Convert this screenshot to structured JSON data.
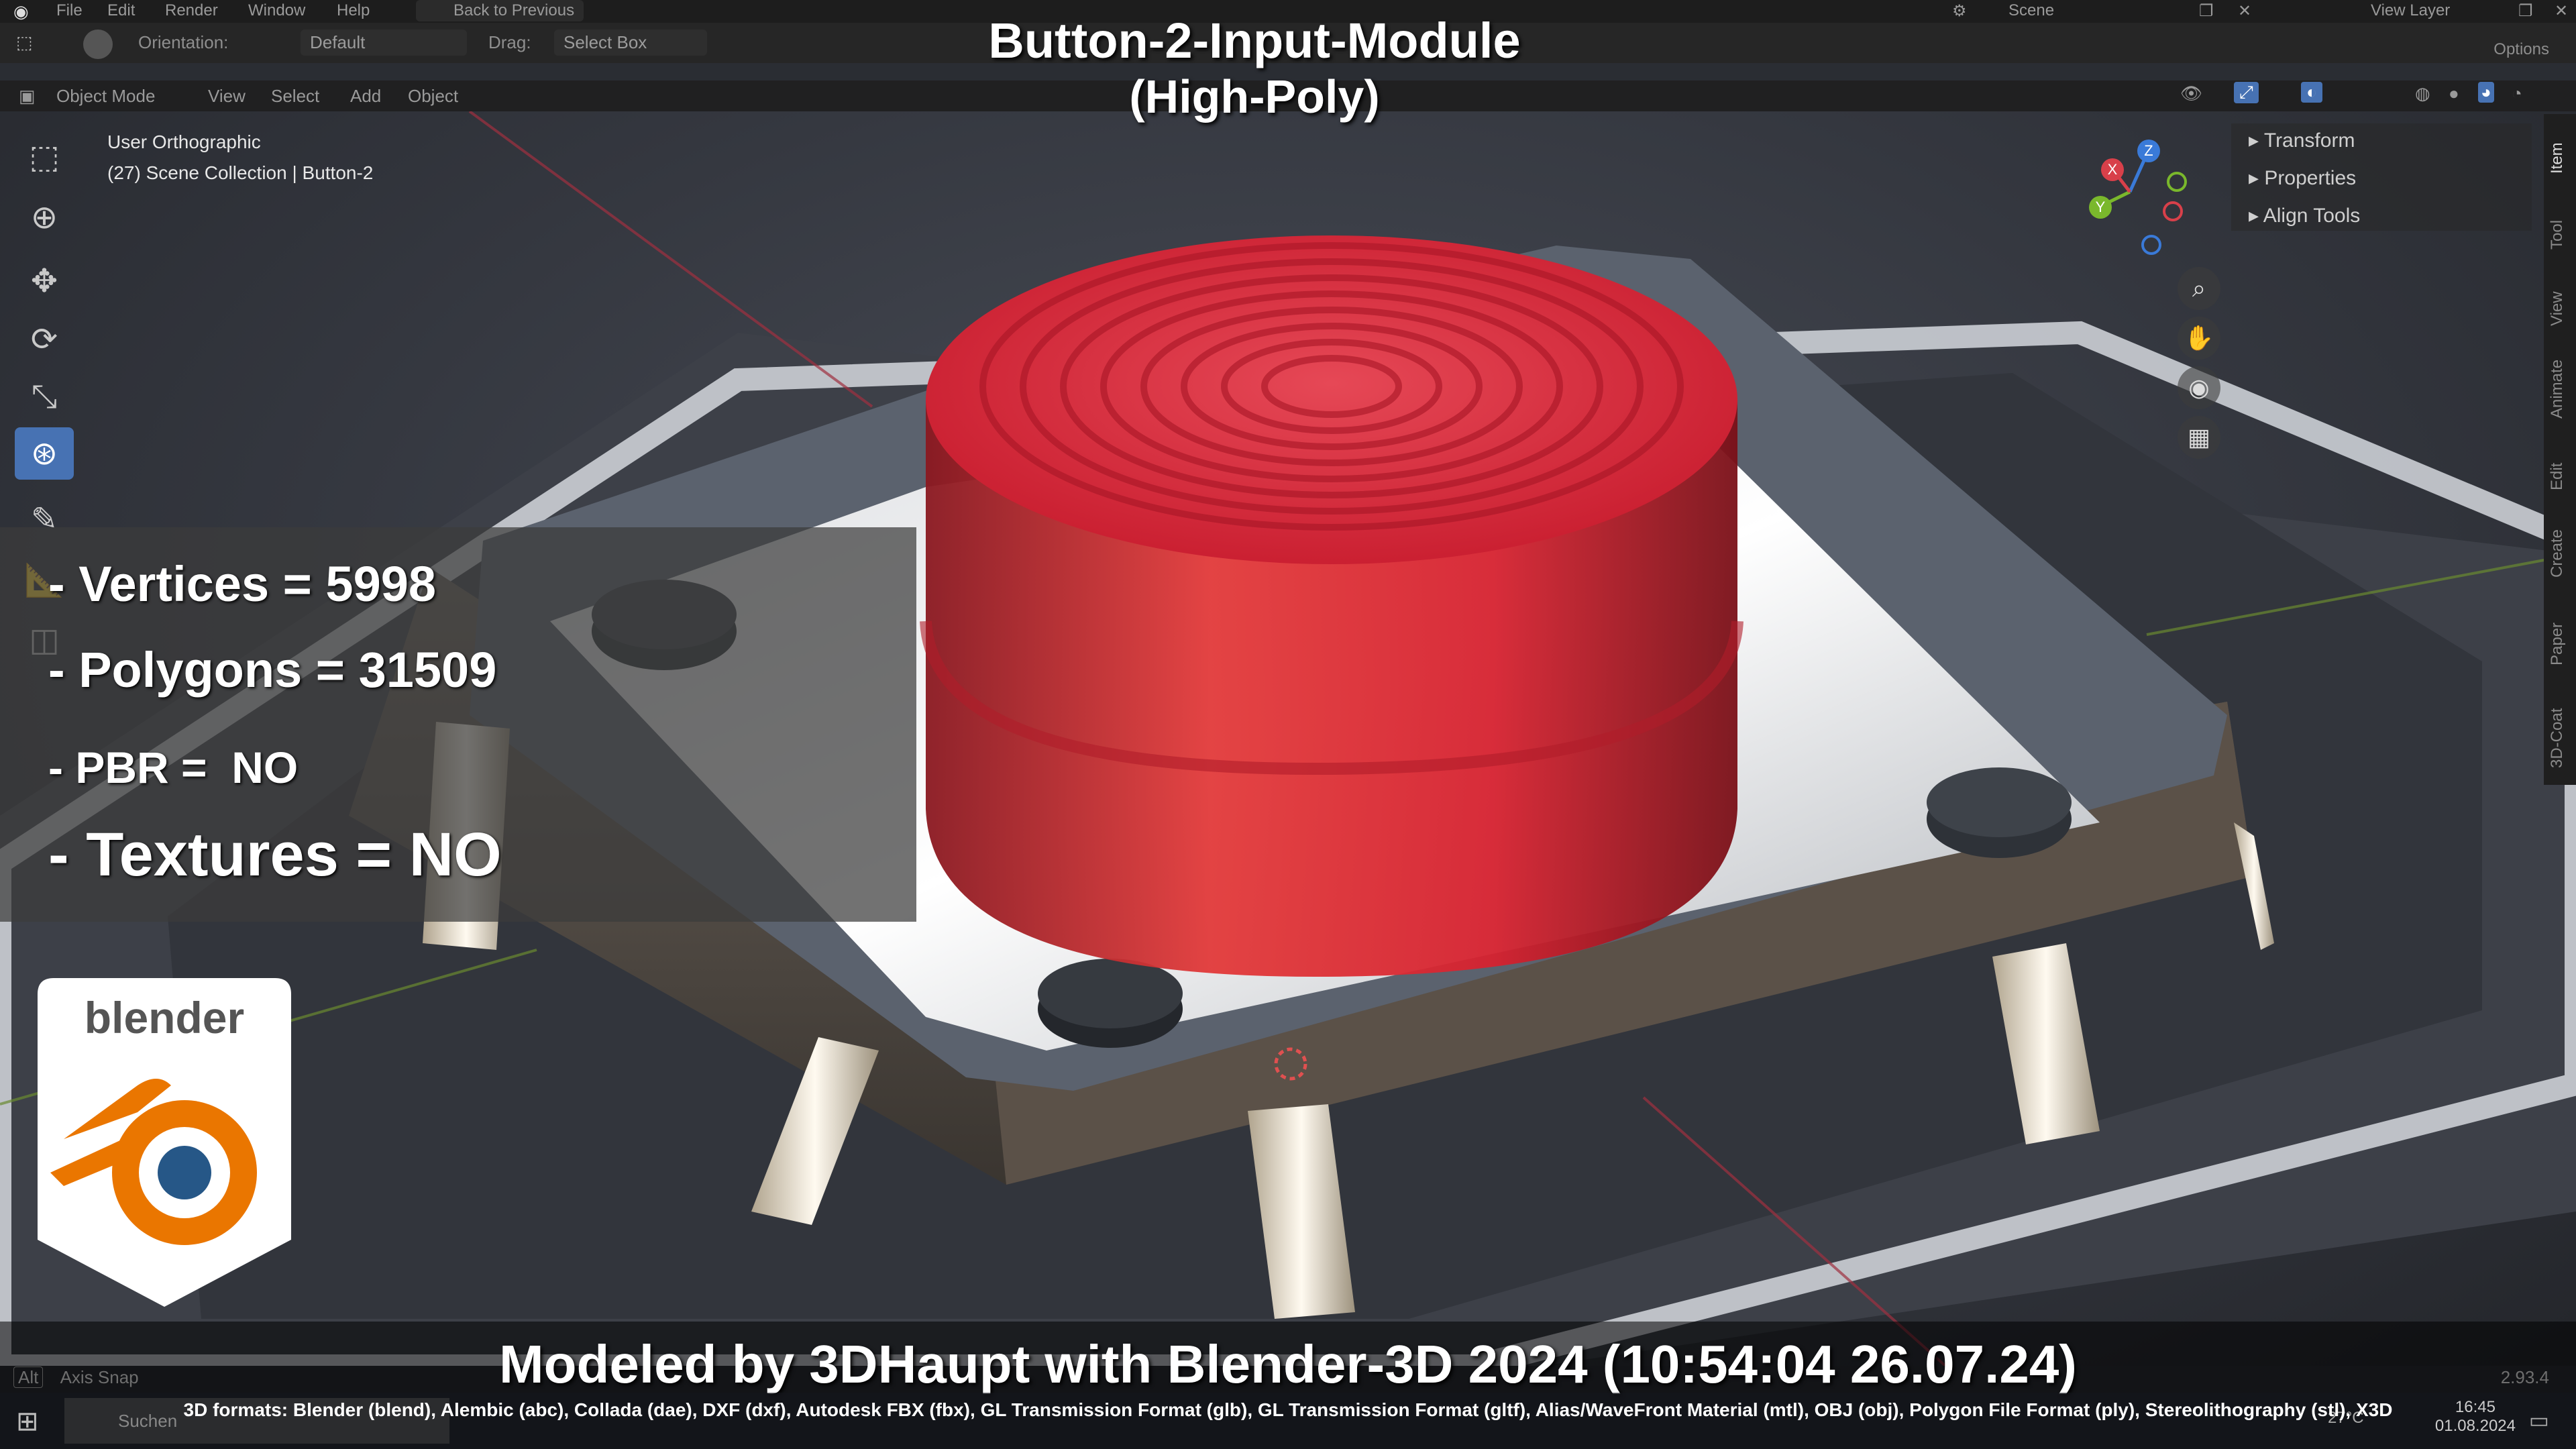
{
  "menubar": {
    "items": [
      "File",
      "Edit",
      "Render",
      "Window",
      "Help"
    ],
    "back_button": "Back to Previous",
    "scene_label": "Scene",
    "view_layer_label": "View Layer"
  },
  "toolheader": {
    "orientation_label": "Orientation:",
    "orientation_value": "Default",
    "drag_label": "Drag:",
    "drag_value": "Select Box",
    "options_label": "Options"
  },
  "viewheader": {
    "mode": "Object Mode",
    "menus": [
      "View",
      "Select",
      "Add",
      "Object"
    ]
  },
  "viewport": {
    "view_name": "User Orthographic",
    "collection_info": "(27) Scene Collection | Button-2"
  },
  "npanel": {
    "items": [
      "Transform",
      "Properties",
      "Align Tools"
    ]
  },
  "sidetabs": [
    "Item",
    "Tool",
    "View",
    "Animate",
    "Edit",
    "Create",
    "Paper",
    "3D-Coat"
  ],
  "gizmo": {
    "x": "X",
    "y": "Y",
    "z": "Z"
  },
  "overlay": {
    "title_line1": "Button-2-Input-Module",
    "title_line2": "(High-Poly)",
    "stat_vertices": "- Vertices = 5998",
    "stat_polygons": "- Polygons = 31509",
    "stat_pbr": "- PBR =  NO",
    "stat_textures": "- Textures = NO",
    "modeled_by": "Modeled by 3DHaupt with Blender-3D 2024 (10:54:04  26.07.24)",
    "formats": "3D formats: Blender (blend), Alembic (abc), Collada (dae), DXF (dxf), Autodesk FBX (fbx), GL Transmission Format (glb), GL Transmission Format (gltf), Alias/WaveFront Material (mtl), OBJ (obj), Polygon File Format (ply), Stereolithography (stl), X3D"
  },
  "logo": {
    "wordmark": "blender"
  },
  "statusbar": {
    "left": "Axis Snap",
    "alt_key": "Alt",
    "version": "2.93.4"
  },
  "taskbar": {
    "search_placeholder": "Suchen",
    "time": "16:45",
    "date": "01.08.2024",
    "temperature": "27°C"
  },
  "colors": {
    "accent": "#4772b3",
    "button_red": "#e8283a",
    "blender_orange": "#ea7600",
    "blender_blue": "#265787"
  }
}
